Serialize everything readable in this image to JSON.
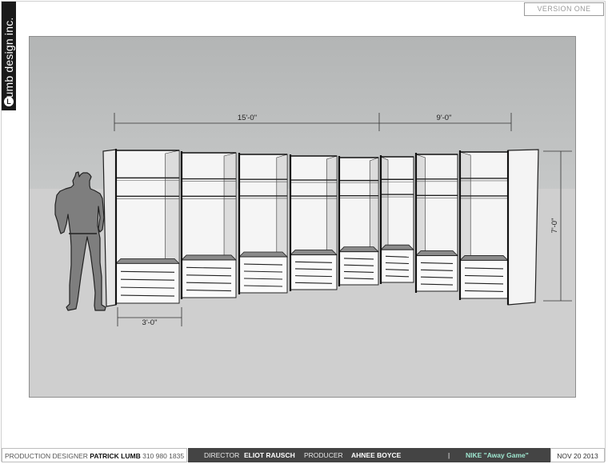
{
  "brand": {
    "name": "umb design inc.",
    "mark": "L"
  },
  "version": "VERSION ONE",
  "dimensions": {
    "width_long": "15'-0\"",
    "width_short": "9'-0\"",
    "height": "7'-0\"",
    "depth": "3'-0\""
  },
  "footer": {
    "designer_label": "PRODUCTION DESIGNER",
    "designer_name": "PATRICK LUMB",
    "designer_phone": "310 980 1835",
    "director_label": "DIRECTOR",
    "director_name": "ELIOT RAUSCH",
    "producer_label": "PRODUCER",
    "producer_name": "AHNEE  BOYCE",
    "separator": "|",
    "project": "NIKE \"Away Game\"",
    "date": "NOV 20 2013"
  }
}
